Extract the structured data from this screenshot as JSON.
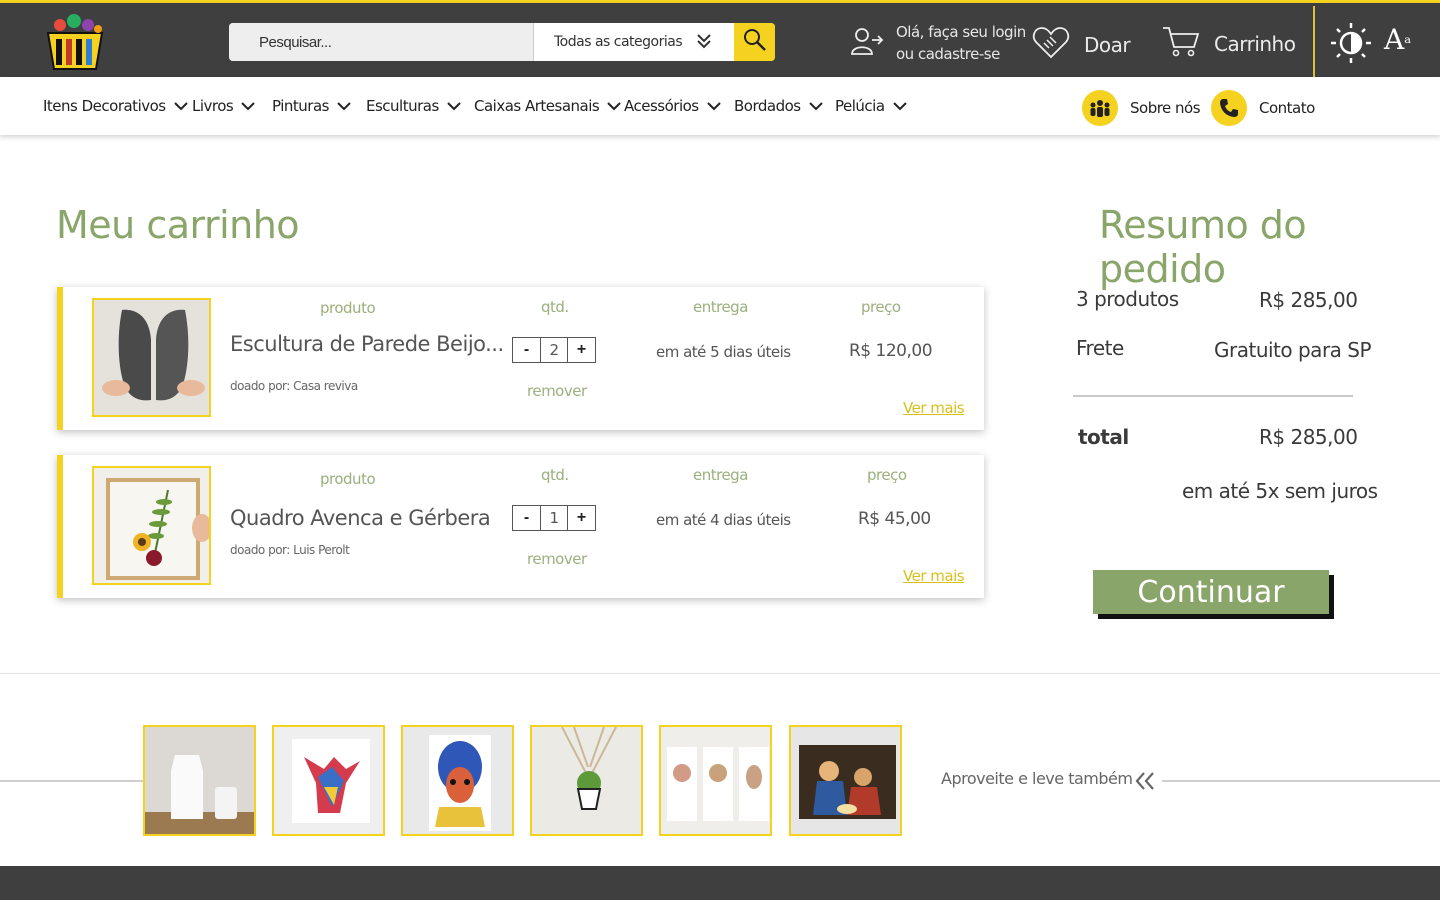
{
  "header": {
    "search_placeholder": "Pesquisar...",
    "category_select": "Todas as categorias",
    "login_line1": "Olá, faça seu login",
    "login_line2": "ou cadastre-se",
    "donate_label": "Doar",
    "cart_label": "Carrinho",
    "font_size_label": "A"
  },
  "nav": {
    "items": [
      "Itens Decorativos",
      "Livros",
      "Pinturas",
      "Esculturas",
      "Caixas Artesanais",
      "Acessórios",
      "Bordados",
      "Pelúcia"
    ],
    "about_label": "Sobre nós",
    "contact_label": "Contato"
  },
  "cart": {
    "title": "Meu carrinho",
    "col_product": "produto",
    "col_qty": "qtd.",
    "col_delivery": "entrega",
    "col_price": "preço",
    "remove_label": "remover",
    "more_label": "Ver mais",
    "items": [
      {
        "name": "Escultura de Parede Beijo...",
        "donor": "doado por: Casa reviva",
        "qty": "2",
        "delivery": "em até 5 dias úteis",
        "price": "R$ 120,00"
      },
      {
        "name": "Quadro Avenca e Gérbera",
        "donor": "doado por: Luis Perolt",
        "qty": "1",
        "delivery": "em até 4 dias úteis",
        "price": "R$ 45,00"
      }
    ]
  },
  "summary": {
    "title": "Resumo do pedido",
    "products_label": "3 produtos",
    "products_value": "R$ 285,00",
    "shipping_label": "Frete",
    "shipping_value": "Gratuito para SP",
    "total_label": "total",
    "total_value": "R$ 285,00",
    "installments": "em até 5x sem juros",
    "continue_label": "Continuar"
  },
  "suggestions": {
    "title": "Aproveite e leve também"
  },
  "colors": {
    "accent_yellow": "#f4d21f",
    "accent_green": "#8aa56a",
    "header_bg": "#3f3f3f"
  }
}
